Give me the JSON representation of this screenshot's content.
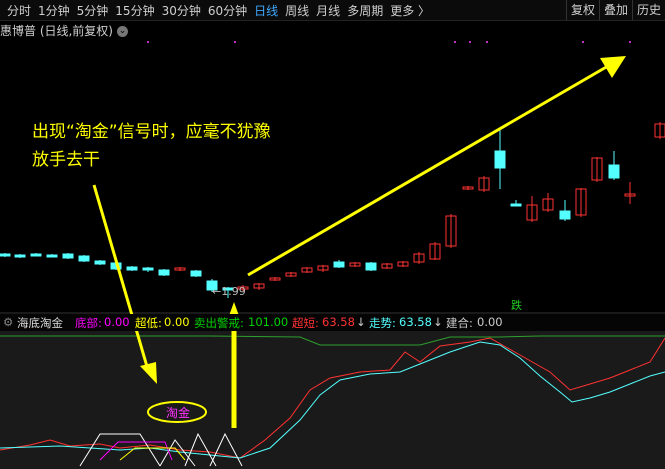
{
  "toolbar": {
    "periods": [
      "分时",
      "1分钟",
      "5分钟",
      "15分钟",
      "30分钟",
      "60分钟",
      "日线",
      "周线",
      "月线",
      "多周期",
      "更多 〉"
    ],
    "active_period": "日线",
    "right_buttons": [
      "复权",
      "叠加",
      "历史"
    ]
  },
  "stock_title": "惠博普 (日线,前复权)",
  "title_dropdown_icon": "chevron-down-icon",
  "annotation": {
    "line1": "出现“淘金”信号时，应毫不犹豫",
    "line2": "放手去干"
  },
  "price_low_label": "←1.99",
  "fall_mark": "跌",
  "indicator": {
    "name": "海底淘金",
    "bottom": {
      "label": "底部:",
      "value": "0.00"
    },
    "oversold": {
      "label": "超低:",
      "value": "0.00"
    },
    "sell_warning": {
      "label": "卖出警戒:",
      "value": "101.00"
    },
    "overbought": {
      "label": "超短:",
      "value": "63.58"
    },
    "trend": {
      "label": "走势:",
      "value": "63.58"
    },
    "buy_in": {
      "label": "建合:",
      "value": "0.00"
    },
    "signal_label": "淘金"
  },
  "colors": {
    "up": "#ff3232",
    "down": "#54ffff",
    "annotation": "#ffff00",
    "active_tab": "#3fa9ff",
    "bottom": "#ff00ff",
    "sell_warning": "#00d000",
    "trend": "#54ffff"
  }
}
